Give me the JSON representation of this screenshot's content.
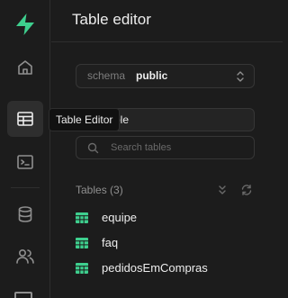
{
  "tooltip": "Table Editor",
  "rail": {
    "items": [
      {
        "icon": "supabase-logo-icon"
      },
      {
        "icon": "home-icon"
      },
      {
        "icon": "table-icon",
        "active": true
      },
      {
        "icon": "terminal-icon"
      },
      {
        "icon": "database-icon"
      },
      {
        "icon": "users-icon"
      }
    ]
  },
  "panel": {
    "title": "Table editor",
    "schema": {
      "label": "schema",
      "value": "public"
    },
    "new_table_label": "w table",
    "search": {
      "placeholder": "Search tables"
    },
    "tables_header": "Tables (3)",
    "tables": [
      {
        "name": "equipe"
      },
      {
        "name": "faq"
      },
      {
        "name": "pedidosEmCompras"
      }
    ]
  },
  "colors": {
    "background": "#1c1c1c",
    "border": "#2e2e2e",
    "brand_green": "#3ecf8e",
    "text": "#ededed",
    "muted": "#8f8f8f"
  }
}
